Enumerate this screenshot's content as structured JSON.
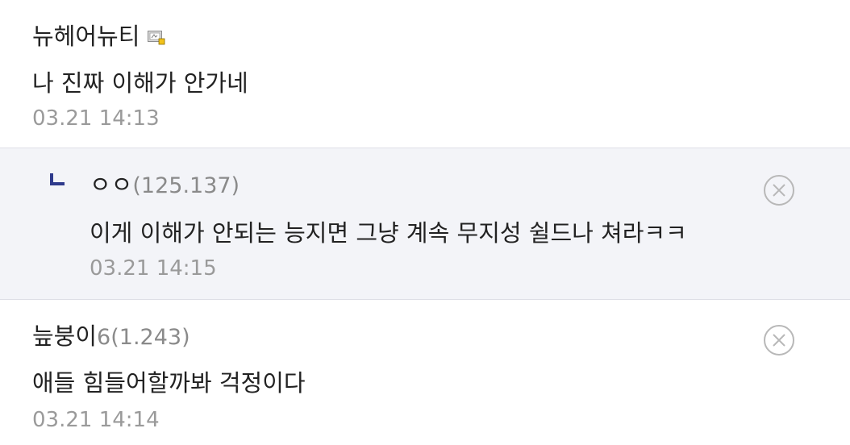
{
  "comments": [
    {
      "name": "뉴헤어뉴티",
      "name_icon": "gallery-nick-icon",
      "text": "나 진짜 이해가 안가네",
      "time": "03.21 14:13"
    },
    {
      "reply_icon": "reply-arrow-icon",
      "name": "ㅇㅇ",
      "ip": "(125.137)",
      "text": "이게 이해가 안되는 능지면 그냥 계속 무지성 쉴드나 쳐라ㅋㅋ",
      "time": "03.21 14:15",
      "delete_icon": "delete-circle-x-icon"
    },
    {
      "name": "늪붕이",
      "level": "6",
      "ip": "(1.243)",
      "text": "애들 힘들어할까봐 걱정이다",
      "time": "03.21 14:14",
      "delete_icon": "delete-circle-x-icon"
    }
  ],
  "colors": {
    "reply_background": "#f3f4f8",
    "divider": "#dedfe6",
    "reply_mark": "#2e3a8c",
    "muted_text": "#8a8a8a"
  }
}
